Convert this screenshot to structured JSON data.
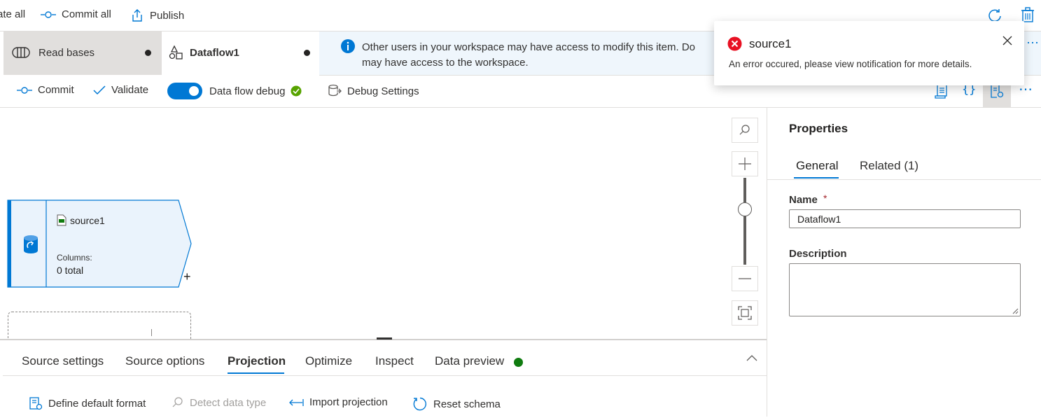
{
  "topbar": {
    "validate_all_label": "ate all",
    "commit_all_label": "Commit all",
    "publish_label": "Publish"
  },
  "tabs": [
    {
      "label": "Read bases"
    },
    {
      "label": "Dataflow1"
    }
  ],
  "infobar": {
    "line1": "Other users in your workspace may have access to modify this item. Do",
    "line2": "may have access to the workspace."
  },
  "toolbar2": {
    "commit_label": "Commit",
    "validate_label": "Validate",
    "debug_label": "Data flow debug",
    "debug_on": true,
    "debug_settings_label": "Debug Settings"
  },
  "canvas": {
    "node": {
      "name": "source1",
      "columns_label": "Columns:",
      "columns_value": "0 total",
      "add_symbol": "+"
    },
    "zoom_level": 0.5
  },
  "bottom_panel": {
    "tabs": [
      {
        "label": "Source settings"
      },
      {
        "label": "Source options"
      },
      {
        "label": "Projection",
        "active": true
      },
      {
        "label": "Optimize"
      },
      {
        "label": "Inspect"
      },
      {
        "label": "Data preview"
      }
    ],
    "actions": {
      "define_default_format": "Define default format",
      "detect_data_type": "Detect data type",
      "import_projection": "Import projection",
      "reset_schema": "Reset schema"
    }
  },
  "properties": {
    "title": "Properties",
    "tabs": [
      {
        "label": "General",
        "active": true
      },
      {
        "label": "Related (1)"
      }
    ],
    "name_label": "Name",
    "required_marker": "*",
    "name_value": "Dataflow1",
    "description_label": "Description",
    "description_value": ""
  },
  "toast": {
    "title": "source1",
    "message": "An error occured, please view notification for more details."
  },
  "colors": {
    "accent": "#0078d4",
    "error": "#e81123",
    "success": "#107c10",
    "info_bg": "#eff6fc",
    "node_bg": "#eaf3fc"
  },
  "icons": {
    "refresh": "refresh-icon",
    "discard": "trash-icon",
    "info": "info-icon",
    "error": "error-icon",
    "close": "close-icon"
  }
}
